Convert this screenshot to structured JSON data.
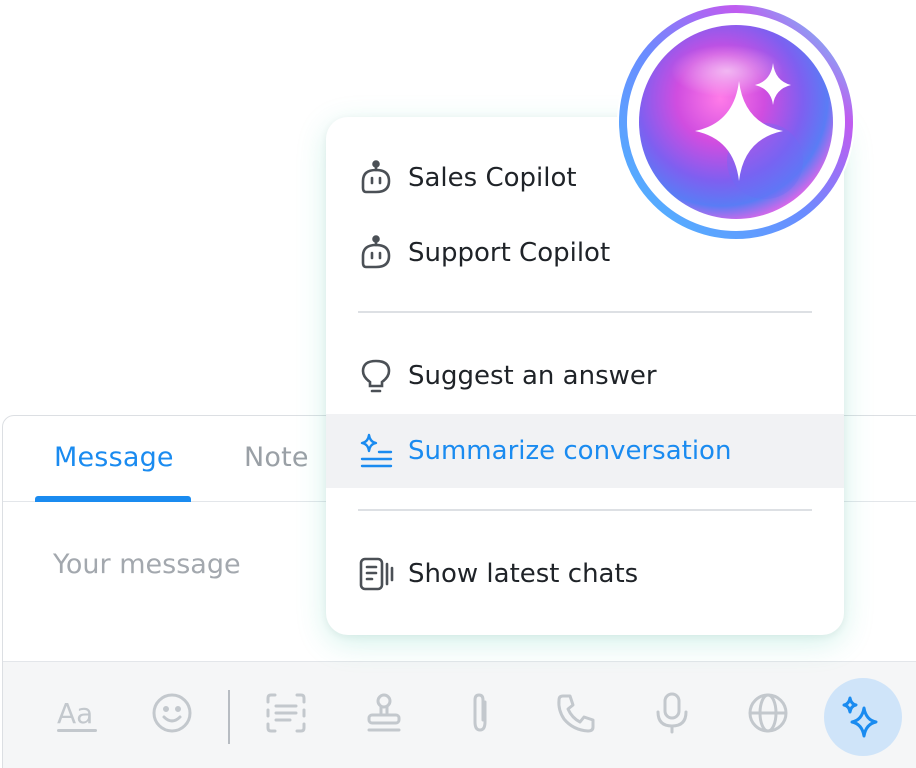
{
  "composer": {
    "tabs": [
      {
        "label": "Message",
        "active": true
      },
      {
        "label": "Note",
        "active": false
      }
    ],
    "message_placeholder": "Your message",
    "toolbar": {
      "icons": [
        "text-format-icon",
        "emoji-icon",
        "canned-response-icon",
        "stamp-icon",
        "attachment-icon",
        "phone-icon",
        "microphone-icon",
        "globe-icon"
      ],
      "ai_button_icon": "sparkle-icon"
    }
  },
  "menu": {
    "items": [
      {
        "label": "Sales Copilot",
        "icon": "robot-icon"
      },
      {
        "label": "Support Copilot",
        "icon": "robot-icon"
      },
      {
        "label": "Suggest an answer",
        "icon": "lightbulb-icon"
      },
      {
        "label": "Summarize conversation",
        "icon": "sparkle-lines-icon",
        "highlighted": true
      },
      {
        "label": "Show latest chats",
        "icon": "chat-history-icon"
      }
    ]
  },
  "colors": {
    "accent": "#1a8bf0",
    "ai_button_bg": "#cfe4f9",
    "toolbar_icons": "#c3c8cd",
    "highlight_bg": "#f1f2f4"
  }
}
